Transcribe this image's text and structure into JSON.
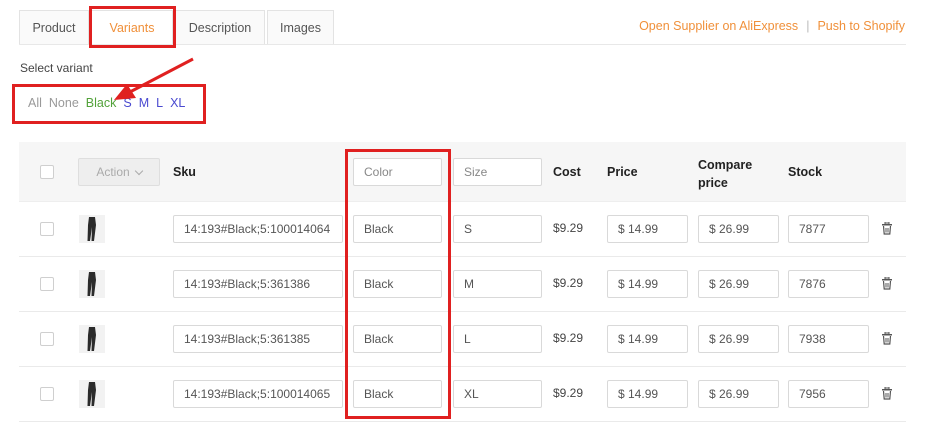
{
  "tabs": [
    {
      "label": "Product"
    },
    {
      "label": "Variants"
    },
    {
      "label": "Description"
    },
    {
      "label": "Images"
    }
  ],
  "header_links": {
    "open_supplier": "Open Supplier on AliExpress",
    "separator": "|",
    "push_shopify": "Push to Shopify"
  },
  "select_variant": {
    "label": "Select variant",
    "filters": {
      "all": "All",
      "none": "None",
      "black": "Black",
      "s": "S",
      "m": "M",
      "l": "L",
      "xl": "XL"
    }
  },
  "table": {
    "headers": {
      "action": "Action",
      "sku": "Sku",
      "color_placeholder": "Color",
      "size_placeholder": "Size",
      "cost": "Cost",
      "price": "Price",
      "compare_price": "Compare price",
      "stock": "Stock"
    },
    "rows": [
      {
        "sku": "14:193#Black;5:100014064",
        "color": "Black",
        "size": "S",
        "cost": "$9.29",
        "price": "$ 14.99",
        "compare": "$ 26.99",
        "stock": "7877"
      },
      {
        "sku": "14:193#Black;5:361386",
        "color": "Black",
        "size": "M",
        "cost": "$9.29",
        "price": "$ 14.99",
        "compare": "$ 26.99",
        "stock": "7876"
      },
      {
        "sku": "14:193#Black;5:361385",
        "color": "Black",
        "size": "L",
        "cost": "$9.29",
        "price": "$ 14.99",
        "compare": "$ 26.99",
        "stock": "7938"
      },
      {
        "sku": "14:193#Black;5:100014065",
        "color": "Black",
        "size": "XL",
        "cost": "$9.29",
        "price": "$ 14.99",
        "compare": "$ 26.99",
        "stock": "7956"
      }
    ]
  },
  "colors": {
    "accent": "#f0903a",
    "annotation": "#e02020",
    "filter_black": "#52a23a",
    "filter_size": "#4a4ad0"
  },
  "icons": {
    "chevron": "chevron-down-icon",
    "trash": "trash-icon",
    "thumbnail": "product-thumbnail"
  }
}
